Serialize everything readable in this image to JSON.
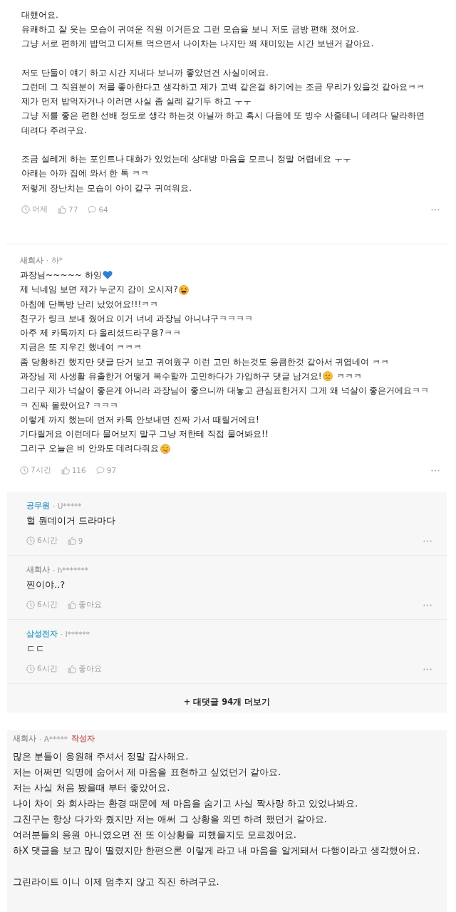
{
  "post": {
    "body": [
      [
        "대했어요.",
        "유쾌하고 잘 웃는 모습이 귀여운 직원 이거든요 그런 모습을 보니 저도 금방 편해 졌어요.",
        "그냥 서로 편하게 밥먹고 디저트 먹으면서 나이차는 나지만 꽤 재미있는 시간 보낸거 같아요."
      ],
      [
        "저도 단둘이 얘기 하고 시간 지내다 보니까 좋았던건 사실이에요.",
        "그런데 그 직원분이 저를 좋아한다고 생각하고 제가 고백 같은걸 하기에는 조금 무리가 있을것 같아요ㅋㅋ",
        "제가 먼저 밥먹자거나 이러면 사실 좀 실례 같기두 하고 ㅜㅜ",
        "그냥 저를 좋은 편한 선배 정도로 생각 하는것 아닐까 하고 혹시 다음에 또 빙수 사줄테니 데려다 달라하면",
        "데려다 주려구요."
      ],
      [
        "조금 설레게 하는 포인트나 대화가 있었는데 상대방 마음을 모르니 정말 어렵네요 ㅜㅜ",
        "아래는 아까 집에 와서 한 톡 ㅋㅋ",
        "저렇게 장난치는 모습이 아이 같구 귀여워요."
      ]
    ],
    "meta": {
      "time": "어제",
      "likes": "77",
      "comments": "64"
    }
  },
  "comment": {
    "author": {
      "company": "새회사",
      "handle": "· 하*",
      "color": "#9b9b9b"
    },
    "body": [
      [
        {
          "kind": "heart",
          "text": "과장님~~~~~ 하잉"
        },
        {
          "kind": "laughing",
          "text": "제 닉네임 보면 제가 누군지 감이 오시져?"
        },
        {
          "kind": "text",
          "text": "아침에 단톡방 난리 났었어요!!!ㅋㅋ"
        },
        {
          "kind": "text",
          "text": "친구가 링크 보내 줬어요 이거 너네 과장님 아니냐구ㅋㅋㅋㅋ"
        },
        {
          "kind": "text",
          "text": "아주 제 카톡까지 다 올리셨드라구용?ㅋㅋ"
        },
        {
          "kind": "text",
          "text": "지금은 또 지우긴 했네여 ㅋㅋㅋ"
        },
        {
          "kind": "text",
          "text": "좀 당황하긴 했지만 댓글 단거 보고 귀여웠구 이런 고민 하는것도 응큼한것 같아서 귀엽네여 ㅋㅋ"
        },
        {
          "kind": "uneasy",
          "text": "과장님 제 사생활 유출한거 어떻게 복수할까 고민하다가 가입하구 댓글 남겨요!",
          "tail": "ㅋㅋㅋ"
        },
        {
          "kind": "text",
          "text": "그리구 제가 넉살이 좋은게 아니라 과장님이 좋으니까 대놓고 관심표한거지 그게 왜 넉살이 좋은거에요ㅋㅋ"
        },
        {
          "kind": "text",
          "text": "ㅋ 진짜 몰랐어요? ㅋㅋㅋ"
        },
        {
          "kind": "text",
          "text": "이렇게 까지 했는데 먼저 카톡 안보내면 진짜 가서 때릴거에요!"
        },
        {
          "kind": "text",
          "text": "기다릴게요 이런데다 물어보지 말구 그냥 저한테 직접 물어봐요!!"
        },
        {
          "kind": "tongue",
          "text": "그리구 오늘은 비 안와도 데려다줘요"
        }
      ]
    ],
    "meta": {
      "time": "7시간",
      "likes": "116",
      "comments": "97"
    }
  },
  "replies": [
    {
      "author": {
        "company": "공무원",
        "handle": "· U*****",
        "color": "#4aa2c9"
      },
      "text": "헐 뭔데이거 드라마다",
      "meta": {
        "time": "6시간",
        "likes": "9"
      }
    },
    {
      "author": {
        "company": "새회사",
        "handle": "· h*******",
        "color": "#9b9b9b"
      },
      "text": "찐이야..?",
      "meta": {
        "time": "6시간",
        "likes": "좋아요"
      }
    },
    {
      "author": {
        "company": "삼성전자",
        "handle": "· l******",
        "color": "#45a6c4"
      },
      "text": "ㄷㄷ",
      "meta": {
        "time": "6시간",
        "likes": "좋아요"
      }
    }
  ],
  "more_replies": "+ 대댓글 94개 더보기",
  "author_reply": {
    "author": {
      "company": "새회사",
      "handle": "· A*****",
      "color": "#9b9b9b",
      "badge": "작성자"
    },
    "body": [
      [
        "많은 분들이 응원해 주셔서 정말 감사해요.",
        "저는 어쩌면 익명에 숨어서 제 마음을 표현하고 싶었던거 같아요.",
        "저는 사실 처음 봤을때 부터 좋았어요.",
        "나이 차이 와 회사라는 환경 때문에 제 마음을 숨기고 사실 짝사랑 하고 있었나봐요.",
        "그친구는 항상 다가와 줬지만 저는 애써 그 상황을 외면 하려 했던거 같아요.",
        "여러분들의 응원 아니였으면 전 또 이상황을 피했을지도 모르겠어요.",
        "하X 댓글을 보고 많이 떨렸지만 한편으론 이렇게 라고 내 마음을 알게돼서 다행이라고 생각했어요."
      ],
      [
        "그린라이트 이니 이제 멈추지 않고 직진 하려구요."
      ]
    ]
  }
}
